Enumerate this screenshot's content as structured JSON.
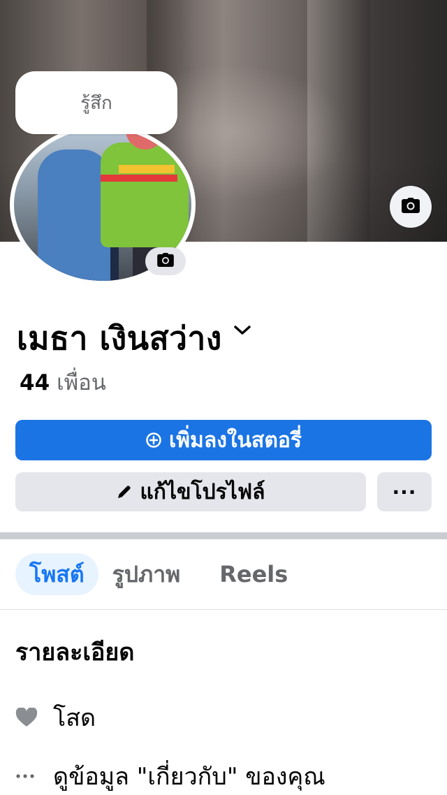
{
  "profile": {
    "feeling_label": "รู้สึก",
    "name": "เมธา เงินสว่าง",
    "friends_count": "44",
    "friends_label": "เพื่อน"
  },
  "actions": {
    "add_story_label": "เพิ่มลงในสตอรี่",
    "edit_profile_label": "แก้ไขโปรไฟล์",
    "more_label": "···"
  },
  "tabs": [
    {
      "label": "โพสต์",
      "active": true
    },
    {
      "label": "รูปภาพ",
      "active": false
    },
    {
      "label": "Reels",
      "active": false
    }
  ],
  "details": {
    "title": "รายละเอียด",
    "items": [
      {
        "icon": "heart-icon",
        "text": "โสด"
      },
      {
        "icon": "dots-icon",
        "text": "ดูข้อมูล \"เกี่ยวกับ\" ของคุณ"
      }
    ]
  },
  "icons": {
    "cover_camera": "camera-icon",
    "avatar_camera": "camera-icon",
    "name_chevron": "chevron-down-icon"
  },
  "colors": {
    "primary": "#1b74e4",
    "secondary_button": "#e4e6eb",
    "active_tab_bg": "#e7f3ff",
    "active_tab_text": "#1877f2"
  }
}
